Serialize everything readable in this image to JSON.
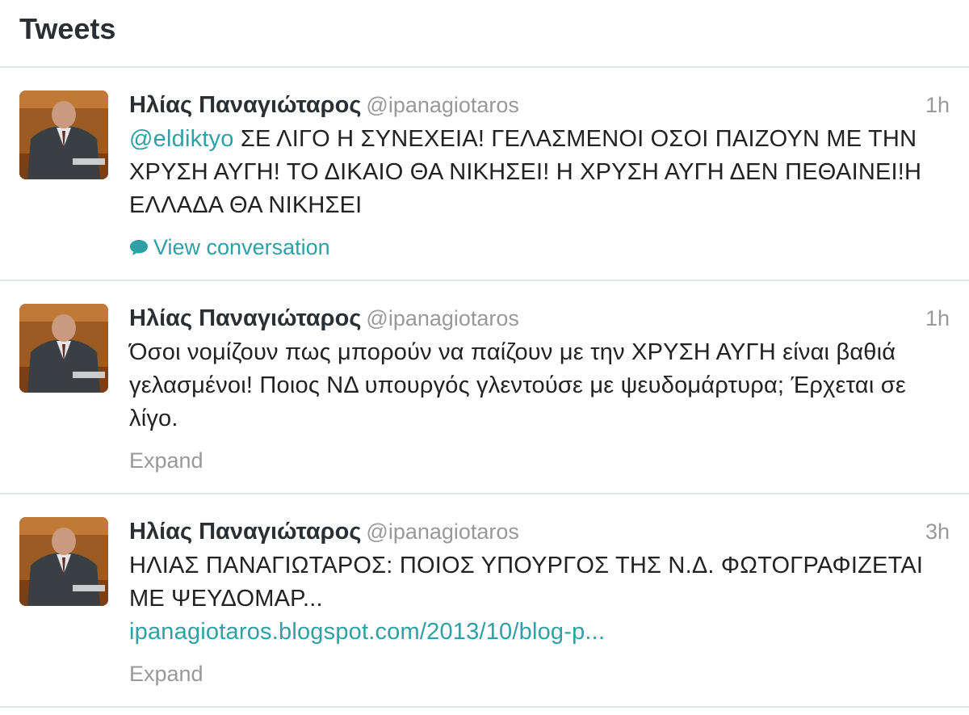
{
  "header": {
    "title": "Tweets"
  },
  "colors": {
    "accent": "#2fa0a6",
    "muted": "#999999",
    "divider": "#e1e8ed"
  },
  "tweets": [
    {
      "fullname": "Ηλίας Παναγιώταρος",
      "username": "@ipanagiotaros",
      "time": "1h",
      "mention": "@eldiktyo",
      "text": " ΣΕ ΛΙΓΟ Η ΣΥΝΕΧΕΙΑ! ΓΕΛΑΣΜΕΝΟΙ ΟΣΟΙ ΠΑΙΖΟΥΝ ΜΕ ΤΗΝ ΧΡΥΣΗ ΑΥΓΗ! ΤΟ ΔΙΚΑΙΟ ΘΑ ΝΙΚΗΣΕΙ! Η ΧΡΥΣΗ ΑΥΓΗ ΔΕΝ ΠΕΘΑΙΝΕΙ!Η ΕΛΛΑΔΑ ΘΑ ΝΙΚΗΣΕΙ",
      "action": "View conversation",
      "action_icon": "speech-bubble-icon"
    },
    {
      "fullname": "Ηλίας Παναγιώταρος",
      "username": "@ipanagiotaros",
      "time": "1h",
      "text": "Όσοι νομίζουν πως μπορούν να παίζουν με την ΧΡΥΣΗ ΑΥΓΗ είναι βαθιά γελασμένοι! Ποιος ΝΔ υπουργός γλεντούσε με ψευδομάρτυρα; Έρχεται σε λίγο.",
      "action": "Expand"
    },
    {
      "fullname": "Ηλίας Παναγιώταρος",
      "username": "@ipanagiotaros",
      "time": "3h",
      "text": "ΗΛΙΑΣ ΠΑΝΑΓΙΩΤΑΡΟΣ: ΠΟΙΟΣ ΥΠΟΥΡΓΟΣ ΤΗΣ Ν.Δ. ΦΩΤΟΓΡΑΦΙΖΕΤΑΙ ΜΕ ΨΕΥΔΟΜΑΡ...",
      "link": "ipanagiotaros.blogspot.com/2013/10/blog-p...",
      "action": "Expand"
    }
  ]
}
